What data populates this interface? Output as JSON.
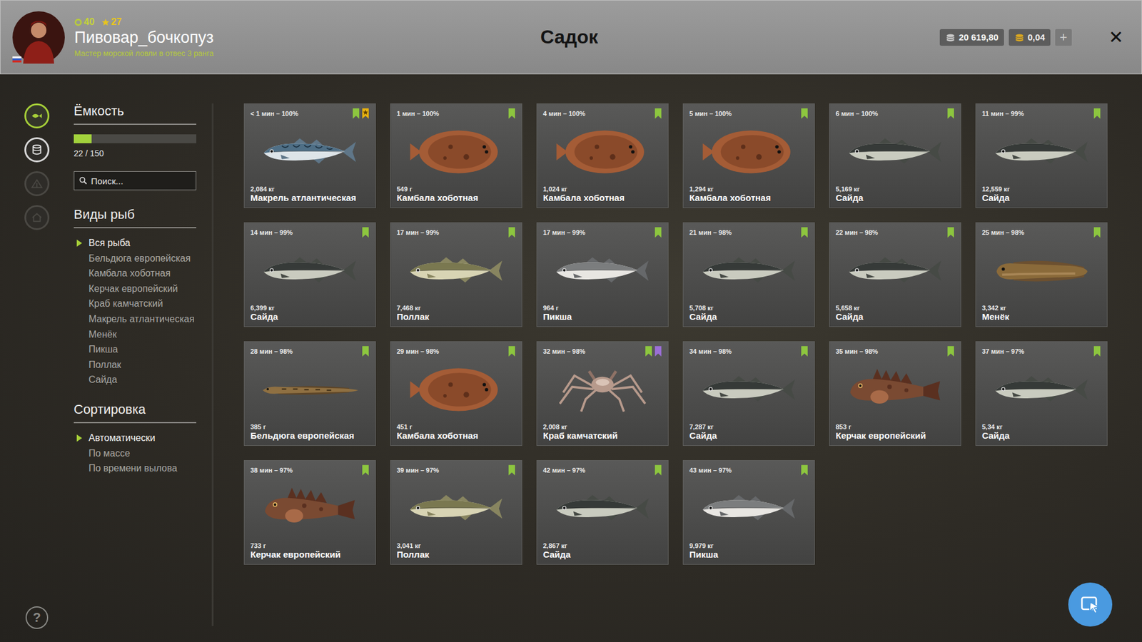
{
  "window": {
    "title": "Садок"
  },
  "player": {
    "name": "Пивовар_бочкопуз",
    "level": "40",
    "rating": "27",
    "rank": "Мастер морской ловли в отвес 3 ранга"
  },
  "currency": [
    {
      "kind": "silver",
      "amount": "20 619,80"
    },
    {
      "kind": "gold",
      "amount": "0,04"
    }
  ],
  "add_button": "+",
  "close_button": "✕",
  "nav": [
    {
      "kind": "fish",
      "selected": true,
      "disabled": false
    },
    {
      "kind": "keepnet",
      "selected": false,
      "disabled": false
    },
    {
      "kind": "craft",
      "selected": false,
      "disabled": true
    },
    {
      "kind": "home",
      "selected": false,
      "disabled": true
    }
  ],
  "help": "?",
  "capacity": {
    "title": "Ёмкость",
    "level": 0.147,
    "reading": "22 / 150"
  },
  "search": {
    "placeholder": "Поиск..."
  },
  "species": {
    "title": "Виды рыб",
    "items": [
      {
        "label": "Вся рыба",
        "selected": true
      },
      {
        "label": "Бельдюга европейская",
        "selected": false
      },
      {
        "label": "Камбала хоботная",
        "selected": false
      },
      {
        "label": "Керчак европейский",
        "selected": false
      },
      {
        "label": "Краб камчатский",
        "selected": false
      },
      {
        "label": "Макрель атлантическая",
        "selected": false
      },
      {
        "label": "Менёк",
        "selected": false
      },
      {
        "label": "Пикша",
        "selected": false
      },
      {
        "label": "Поллак",
        "selected": false
      },
      {
        "label": "Сайда",
        "selected": false
      }
    ]
  },
  "sort": {
    "title": "Сортировка",
    "items": [
      {
        "label": "Автоматически",
        "selected": true
      },
      {
        "label": "По массе",
        "selected": false
      },
      {
        "label": "По времени вылова",
        "selected": false
      }
    ]
  },
  "catches": [
    {
      "time": "< 1 мин – 100%",
      "weight": "2,084 кг",
      "name": "Макрель атлантическая",
      "kind": "mackerel",
      "tags": [
        {
          "kind": "bookmark",
          "color": "#8dc63f"
        },
        {
          "kind": "star",
          "color": "#e8b20e"
        }
      ]
    },
    {
      "time": "1 мин – 100%",
      "weight": "549 г",
      "name": "Камбала хоботная",
      "kind": "flatfish",
      "tags": [
        {
          "kind": "bookmark",
          "color": "#8dc63f"
        }
      ]
    },
    {
      "time": "4 мин – 100%",
      "weight": "1,024 кг",
      "name": "Камбала хоботная",
      "kind": "flatfish",
      "tags": [
        {
          "kind": "bookmark",
          "color": "#8dc63f"
        }
      ]
    },
    {
      "time": "5 мин – 100%",
      "weight": "1,294 кг",
      "name": "Камбала хоботная",
      "kind": "flatfish",
      "tags": [
        {
          "kind": "bookmark",
          "color": "#8dc63f"
        }
      ]
    },
    {
      "time": "6 мин – 100%",
      "weight": "5,169 кг",
      "name": "Сайда",
      "kind": "saithe",
      "tags": [
        {
          "kind": "bookmark",
          "color": "#8dc63f"
        }
      ]
    },
    {
      "time": "11 мин – 99%",
      "weight": "12,559 кг",
      "name": "Сайда",
      "kind": "saithe",
      "tags": [
        {
          "kind": "bookmark",
          "color": "#8dc63f"
        }
      ]
    },
    {
      "time": "14 мин – 99%",
      "weight": "6,399 кг",
      "name": "Сайда",
      "kind": "saithe",
      "tags": [
        {
          "kind": "bookmark",
          "color": "#8dc63f"
        }
      ]
    },
    {
      "time": "17 мин – 99%",
      "weight": "7,468 кг",
      "name": "Поллак",
      "kind": "pollack",
      "tags": [
        {
          "kind": "bookmark",
          "color": "#8dc63f"
        }
      ]
    },
    {
      "time": "17 мин – 99%",
      "weight": "964 г",
      "name": "Пикша",
      "kind": "haddock",
      "tags": [
        {
          "kind": "bookmark",
          "color": "#8dc63f"
        }
      ]
    },
    {
      "time": "21 мин – 98%",
      "weight": "5,708 кг",
      "name": "Сайда",
      "kind": "saithe",
      "tags": [
        {
          "kind": "bookmark",
          "color": "#8dc63f"
        }
      ]
    },
    {
      "time": "22 мин – 98%",
      "weight": "5,658 кг",
      "name": "Сайда",
      "kind": "saithe",
      "tags": [
        {
          "kind": "bookmark",
          "color": "#8dc63f"
        }
      ]
    },
    {
      "time": "25 мин – 98%",
      "weight": "3,342 кг",
      "name": "Менёк",
      "kind": "cusk",
      "tags": [
        {
          "kind": "bookmark",
          "color": "#8dc63f"
        }
      ]
    },
    {
      "time": "28 мин – 98%",
      "weight": "385 г",
      "name": "Бельдюга европейская",
      "kind": "eelpout",
      "tags": [
        {
          "kind": "bookmark",
          "color": "#8dc63f"
        }
      ]
    },
    {
      "time": "29 мин – 98%",
      "weight": "451 г",
      "name": "Камбала хоботная",
      "kind": "flatfish",
      "tags": [
        {
          "kind": "bookmark",
          "color": "#8dc63f"
        }
      ]
    },
    {
      "time": "32 мин – 98%",
      "weight": "2,008 кг",
      "name": "Краб камчатский",
      "kind": "crab",
      "tags": [
        {
          "kind": "bookmark",
          "color": "#8dc63f"
        },
        {
          "kind": "bookmark",
          "color": "#9b6fd6"
        }
      ]
    },
    {
      "time": "34 мин – 98%",
      "weight": "7,287 кг",
      "name": "Сайда",
      "kind": "saithe",
      "tags": [
        {
          "kind": "bookmark",
          "color": "#8dc63f"
        }
      ]
    },
    {
      "time": "35 мин – 98%",
      "weight": "853 г",
      "name": "Керчак европейский",
      "kind": "sculpin",
      "tags": [
        {
          "kind": "bookmark",
          "color": "#8dc63f"
        }
      ]
    },
    {
      "time": "37 мин – 97%",
      "weight": "5,34 кг",
      "name": "Сайда",
      "kind": "saithe",
      "tags": [
        {
          "kind": "bookmark",
          "color": "#8dc63f"
        }
      ]
    },
    {
      "time": "38 мин – 97%",
      "weight": "733 г",
      "name": "Керчак европейский",
      "kind": "sculpin",
      "tags": [
        {
          "kind": "bookmark",
          "color": "#8dc63f"
        }
      ]
    },
    {
      "time": "39 мин – 97%",
      "weight": "3,041 кг",
      "name": "Поллак",
      "kind": "pollack",
      "tags": [
        {
          "kind": "bookmark",
          "color": "#8dc63f"
        }
      ]
    },
    {
      "time": "42 мин – 97%",
      "weight": "2,867 кг",
      "name": "Сайда",
      "kind": "saithe",
      "tags": [
        {
          "kind": "bookmark",
          "color": "#8dc63f"
        }
      ]
    },
    {
      "time": "43 мин – 97%",
      "weight": "9,979 кг",
      "name": "Пикша",
      "kind": "haddock",
      "tags": [
        {
          "kind": "bookmark",
          "color": "#8dc63f"
        }
      ]
    }
  ]
}
